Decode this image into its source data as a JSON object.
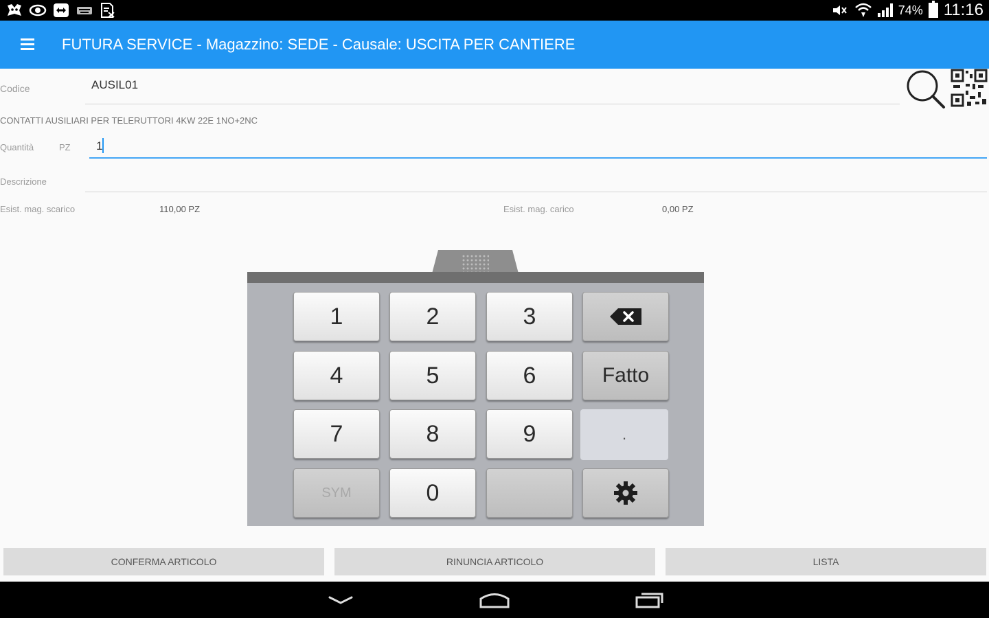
{
  "status": {
    "battery": "74%",
    "time": "11:16",
    "left_icons": [
      "notification-app-icon",
      "eye-icon",
      "teamviewer-icon",
      "keyboard-icon",
      "document-icon"
    ],
    "right_icons": [
      "mute-icon",
      "wifi-icon",
      "signal-icon",
      "battery-icon"
    ]
  },
  "appbar": {
    "title": "FUTURA SERVICE - Magazzino: SEDE - Causale: USCITA PER CANTIERE",
    "menu_icon": "hamburger-menu-icon"
  },
  "form": {
    "codice_label": "Codice",
    "codice_value": "AUSIL01",
    "product_description": "CONTATTI AUSILIARI PER TELERUTTORI 4KW  22E 1NO+2NC",
    "quantita_label": "Quantità",
    "unit": "PZ",
    "quantita_value": "1",
    "descrizione_label": "Descrizione",
    "descrizione_value": "",
    "esist_scarico_label": "Esist. mag. scarico",
    "esist_scarico_value": "110,00 PZ",
    "esist_carico_label": "Esist. mag. carico",
    "esist_carico_value": "0,00 PZ"
  },
  "keypad": {
    "keys": [
      "1",
      "2",
      "3",
      "4",
      "5",
      "6",
      "7",
      "8",
      "9",
      "0"
    ],
    "done_label": "Fatto",
    "dot_label": ".",
    "sym_label": "SYM",
    "backspace_icon": "backspace-icon",
    "settings_icon": "gear-icon"
  },
  "buttons": {
    "confirm": "CONFERMA ARTICOLO",
    "cancel": "RINUNCIA ARTICOLO",
    "list": "LISTA"
  },
  "nav": {
    "icons": [
      "back-icon",
      "home-icon",
      "recents-icon"
    ]
  }
}
